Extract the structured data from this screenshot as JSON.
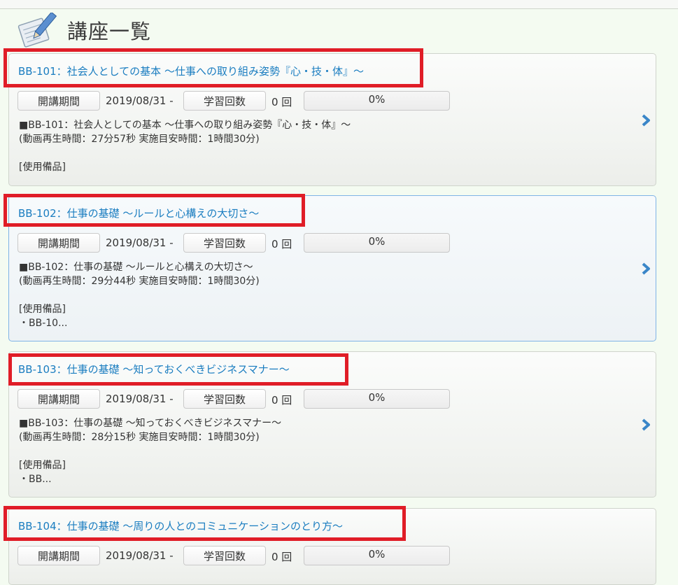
{
  "page": {
    "title": "講座一覧",
    "icon": "notepad-pencil-icon"
  },
  "labels": {
    "period": "開講期間",
    "count": "学習回数"
  },
  "courses": [
    {
      "title": "BB-101：社会人としての基本 ～仕事への取り組み姿勢『心・技・体』～",
      "date": "2019/08/31 -",
      "count": "0 回",
      "progress": "0%",
      "line1": "■BB-101：社会人としての基本 ～仕事への取り組み姿勢『心・技・体』～",
      "line2": "(動画再生時間：27分57秒 実施目安時間：1時間30分)",
      "line3": "",
      "line4": "[使用備品]",
      "line5": ""
    },
    {
      "title": "BB-102：仕事の基礎 ～ルールと心構えの大切さ～",
      "date": "2019/08/31 -",
      "count": "0 回",
      "progress": "0%",
      "line1": "■BB-102：仕事の基礎 ～ルールと心構えの大切さ～",
      "line2": "(動画再生時間：29分44秒 実施目安時間：1時間30分)",
      "line3": "",
      "line4": "[使用備品]",
      "line5": "・BB-10..."
    },
    {
      "title": "BB-103：仕事の基礎 ～知っておくべきビジネスマナー～",
      "date": "2019/08/31 -",
      "count": "0 回",
      "progress": "0%",
      "line1": "■BB-103：仕事の基礎 ～知っておくべきビジネスマナー～",
      "line2": "(動画再生時間：28分15秒 実施目安時間：1時間30分)",
      "line3": "",
      "line4": "[使用備品]",
      "line5": "・BB..."
    },
    {
      "title": "BB-104：仕事の基礎 ～周りの人とのコミュニケーションのとり方～",
      "date": "2019/08/31 -",
      "count": "0 回",
      "progress": "0%"
    }
  ],
  "colors": {
    "highlight": "#e01d27",
    "link": "#1a7dc0",
    "chevron": "#3a86c8",
    "active_border": "#7fb3e6"
  }
}
